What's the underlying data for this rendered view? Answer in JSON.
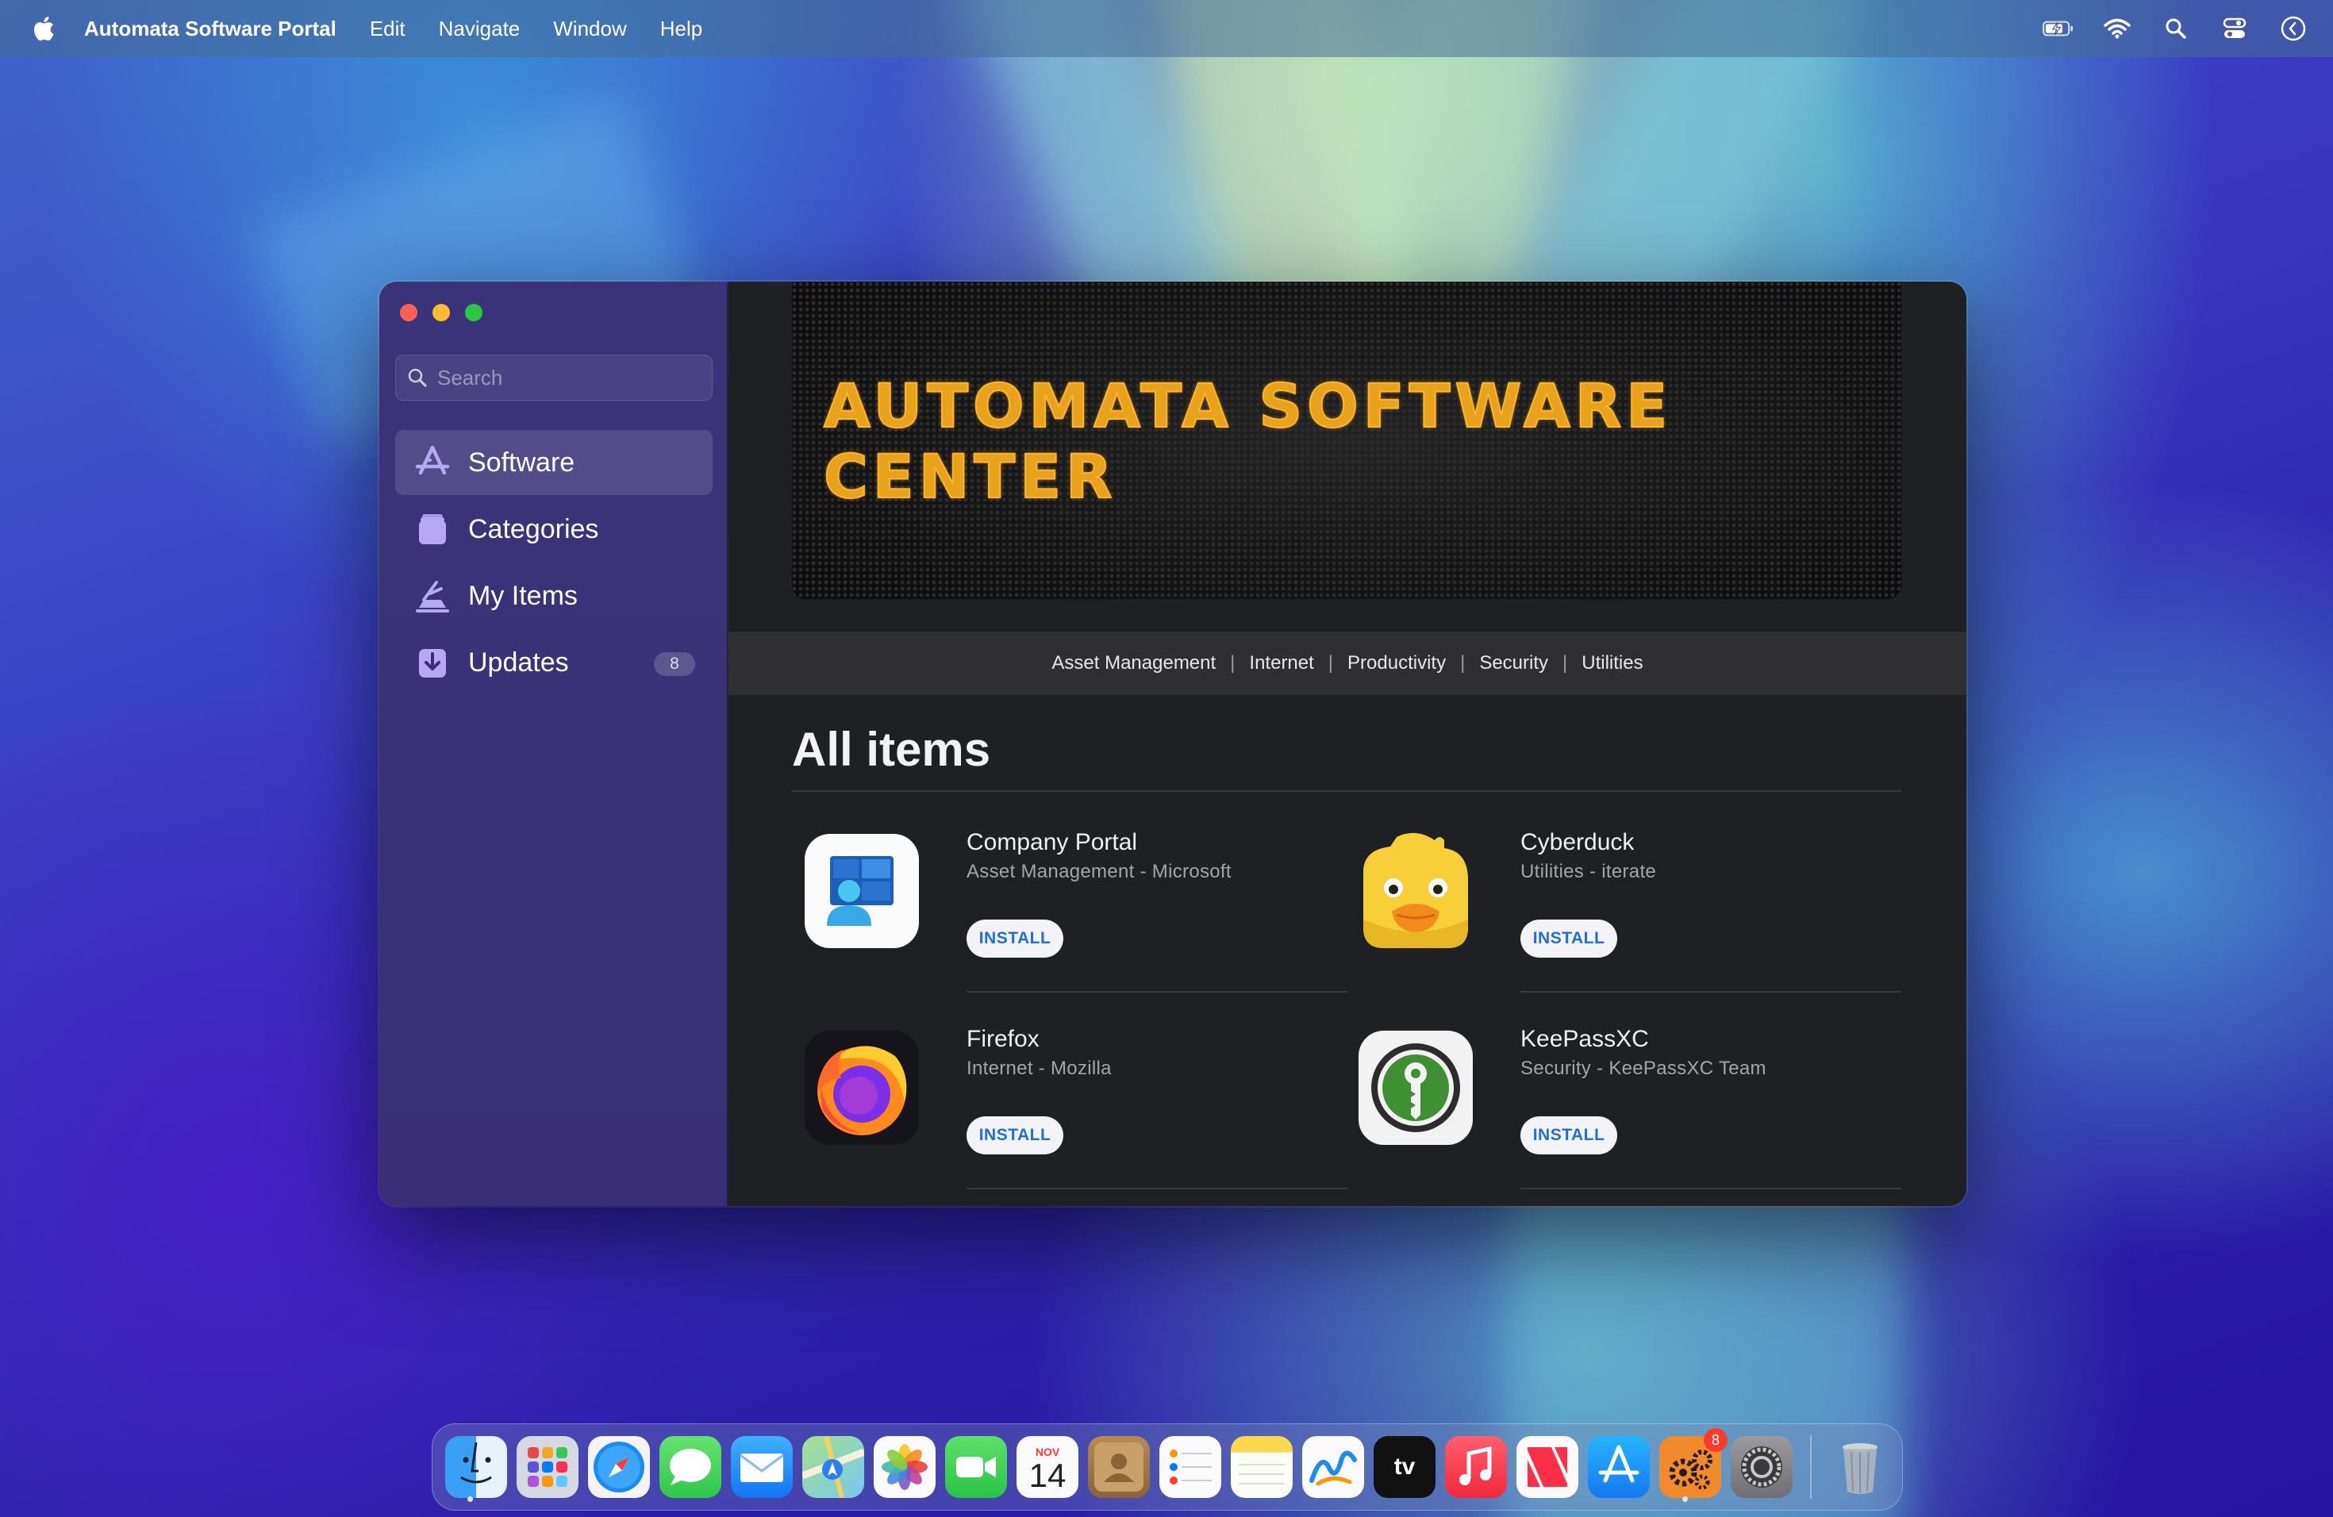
{
  "menubar": {
    "app_name": "Automata Software Portal",
    "items": [
      "Edit",
      "Navigate",
      "Window",
      "Help"
    ],
    "status_icons": [
      "battery-charging-icon",
      "wifi-icon",
      "spotlight-search-icon",
      "control-center-icon",
      "clock-icon"
    ]
  },
  "window": {
    "search": {
      "placeholder": "Search",
      "value": ""
    },
    "sidebar": {
      "items": [
        {
          "label": "Software",
          "icon": "app-store-a-icon",
          "active": true
        },
        {
          "label": "Categories",
          "icon": "categories-stack-icon",
          "active": false
        },
        {
          "label": "My Items",
          "icon": "my-items-tray-icon",
          "active": false
        },
        {
          "label": "Updates",
          "icon": "updates-download-icon",
          "active": false,
          "badge": "8"
        }
      ]
    },
    "banner": {
      "title": "AUTOMATA SOFTWARE CENTER"
    },
    "categories": [
      "Asset Management",
      "Internet",
      "Productivity",
      "Security",
      "Utilities"
    ],
    "section_title": "All items",
    "apps": [
      {
        "name": "Company Portal",
        "subtitle": "Asset Management - Microsoft",
        "button": "INSTALL",
        "icon": "company-portal-icon"
      },
      {
        "name": "Cyberduck",
        "subtitle": "Utilities - iterate",
        "button": "INSTALL",
        "icon": "cyberduck-icon"
      },
      {
        "name": "Firefox",
        "subtitle": "Internet - Mozilla",
        "button": "INSTALL",
        "icon": "firefox-icon"
      },
      {
        "name": "KeePassXC",
        "subtitle": "Security - KeePassXC Team",
        "button": "INSTALL",
        "icon": "keepassxc-icon"
      }
    ]
  },
  "dock": {
    "apps": [
      "finder-icon",
      "launchpad-icon",
      "safari-icon",
      "messages-icon",
      "mail-icon",
      "maps-icon",
      "photos-icon",
      "facetime-icon",
      "calendar-icon",
      "contacts-icon",
      "reminders-icon",
      "notes-icon",
      "freeform-icon",
      "apple-tv-icon",
      "music-icon",
      "news-icon",
      "app-store-icon",
      "automata-portal-icon",
      "system-settings-icon"
    ],
    "calendar": {
      "month": "NOV",
      "day": "14"
    },
    "tv_label": "tv",
    "portal_badge": "8",
    "trash": "trash-icon"
  },
  "colors": {
    "accent_blue": "#1f6fd6",
    "banner_text": "#e8a21c",
    "sidebar_bg": "#3b3378",
    "content_bg": "#1f2024"
  }
}
